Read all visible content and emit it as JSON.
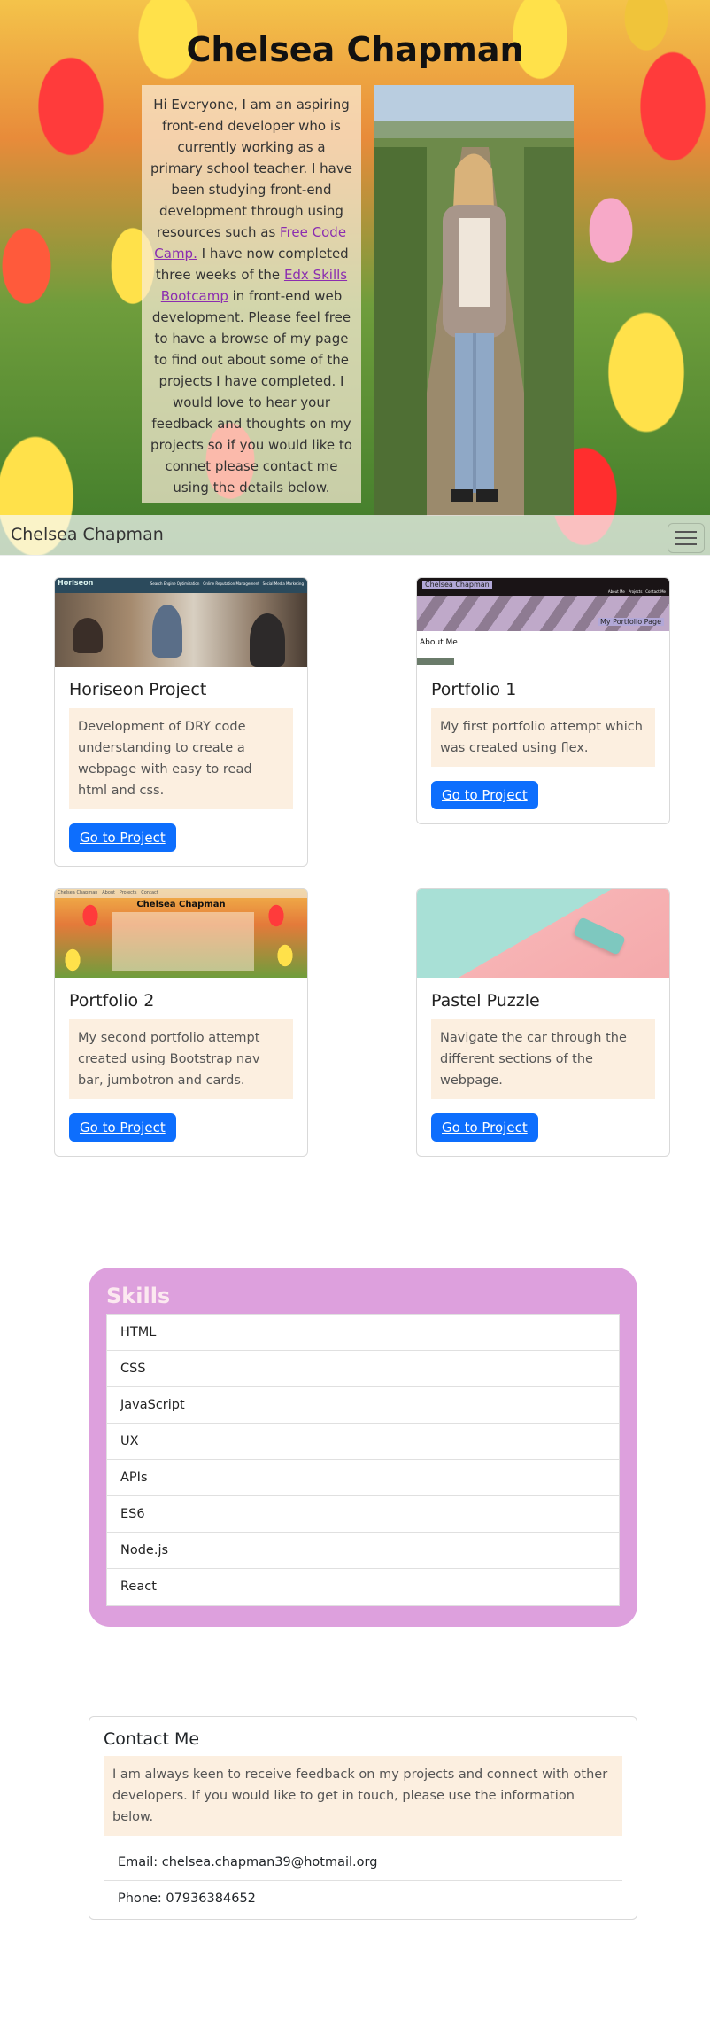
{
  "hero": {
    "title": "Chelsea Chapman",
    "intro_before_fcc": "Hi Everyone, I am an aspiring front-end developer who is currently working as a primary school teacher. I have been studying front-end development through using resources such as ",
    "fcc_link": "Free Code Camp.",
    "intro_middle": " I have now completed three weeks of the ",
    "edx_link": "Edx Skills Bootcamp",
    "intro_after": " in front-end web development. Please feel free to have a browse of my page to find out about some of the projects I have completed. I would love to hear your feedback and thoughts on my projects so if you would like to connet please contact me using the details below."
  },
  "navbar": {
    "brand": "Chelsea Chapman",
    "toggler_icon": "hamburger-icon"
  },
  "projects": [
    {
      "title": "Horiseon Project",
      "text": "Development of DRY code understanding to create a webpage with easy to read html and css.",
      "button": "Go to Project",
      "thumb_brand": "Horiseon",
      "thumb_nav": "Search Engine Optimization   Online Reputation Management   Social Media Marketing"
    },
    {
      "title": "Portfolio 1",
      "text": "My first portfolio attempt which was created using flex.",
      "button": "Go to Project",
      "thumb_brand": "Chelsea Chapman",
      "thumb_nav": "About Me   Projects   Contact Me",
      "thumb_page": "My Portfolio Page",
      "thumb_section": "About Me"
    },
    {
      "title": "Portfolio 2",
      "text": "My second portfolio attempt created using Bootstrap nav bar, jumbotron and cards.",
      "button": "Go to Project",
      "thumb_heading": "Chelsea Chapman",
      "thumb_nav": "Chelsea Chapman   About   Projects   Contact"
    },
    {
      "title": "Pastel Puzzle",
      "text": "Navigate the car through the different sections of the webpage.",
      "button": "Go to Project"
    }
  ],
  "skills": {
    "title": "Skills",
    "items": [
      "HTML",
      "CSS",
      "JavaScript",
      "UX",
      "APIs",
      "ES6",
      "Node.js",
      "React"
    ]
  },
  "contact": {
    "title": "Contact Me",
    "text": "I am always keen to receive feedback on my projects and connect with other developers. If you would like to get in touch, please use the information below.",
    "email": "Email: chelsea.chapman39@hotmail.org",
    "phone": "Phone: 07936384652"
  },
  "colors": {
    "button": "#0d6efd",
    "skills_bg": "#dda0dd",
    "highlight_bg": "#fcefe0"
  }
}
